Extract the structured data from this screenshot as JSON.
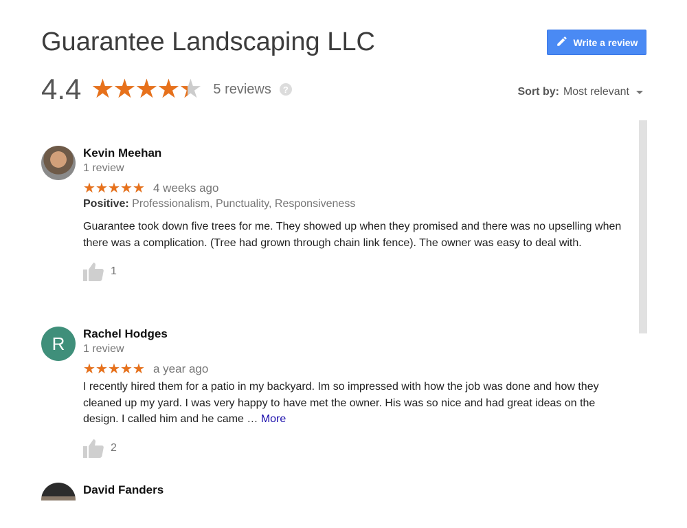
{
  "business": {
    "name": "Guarantee Landscaping LLC"
  },
  "summary": {
    "rating": "4.4",
    "rating_value": 4.4,
    "reviews_label": "5 reviews"
  },
  "write_review": {
    "label": "Write a review"
  },
  "sort": {
    "label": "Sort by:",
    "value": "Most relevant"
  },
  "colors": {
    "star": "#e7711b",
    "button": "#4a8af4",
    "link": "#1a0dab",
    "avatar_rh": "#3f8f7a"
  },
  "reviews": [
    {
      "name": "Kevin Meehan",
      "count": "1 review",
      "stars": 5,
      "ago": "4 weeks ago",
      "positive_label": "Positive:",
      "positive": "Professionalism, Punctuality, Responsiveness",
      "text": "Guarantee took down five trees for me. They showed up when they promised and there was no upselling when there was a complication. (Tree had grown through chain link fence). The owner was easy to deal with.",
      "likes": "1"
    },
    {
      "name": "Rachel Hodges",
      "avatar_letter": "R",
      "count": "1 review",
      "stars": 5,
      "ago": "a year ago",
      "text": "I recently hired them for a patio in my backyard. Im so impressed with how the job was done and how they cleaned up my yard. I was very happy to have met the owner. His was so nice and had great ideas on the design. I called him and he came …",
      "more": "More",
      "likes": "2"
    },
    {
      "name": "David Fanders"
    }
  ],
  "icons": [
    "pencil-icon",
    "help-icon",
    "caret-down-icon",
    "thumbs-up-icon",
    "star-icon"
  ]
}
